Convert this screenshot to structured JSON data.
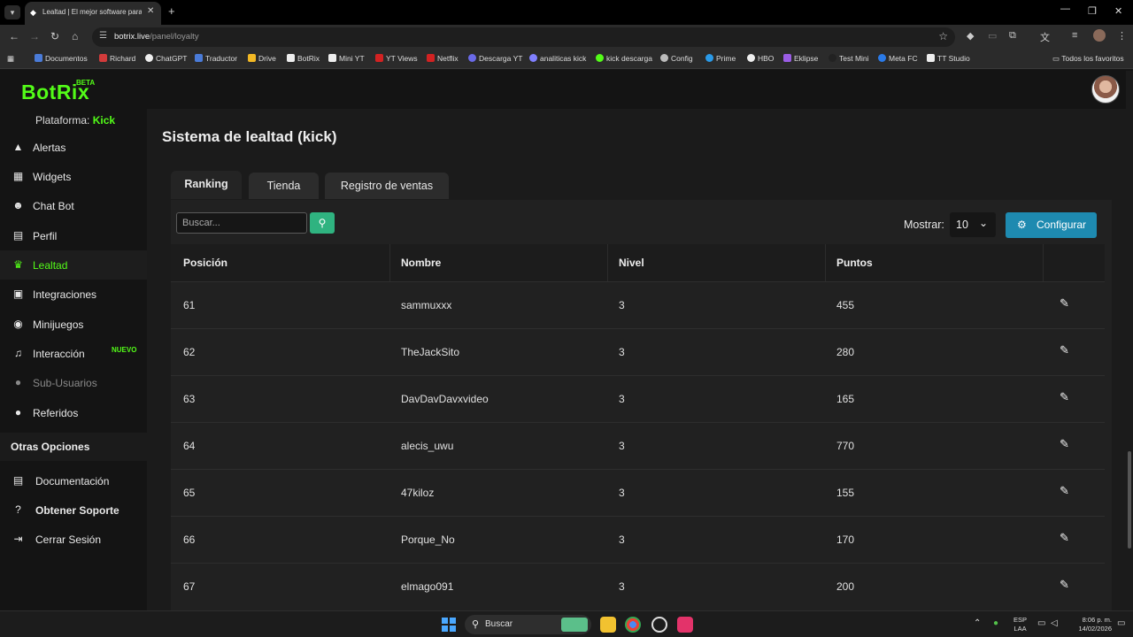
{
  "browser": {
    "tab_title": "Lealtad | El mejor software para",
    "url_host": "botrix.live",
    "url_path": "/panel/loyalty",
    "bookmarks": [
      {
        "label": "Documentos",
        "color": "#4a7bd8"
      },
      {
        "label": "Richard",
        "color": "#d23b3b"
      },
      {
        "label": "ChatGPT",
        "color": "#eeeeee"
      },
      {
        "label": "Traductor",
        "color": "#4a7bd8"
      },
      {
        "label": "Drive",
        "color": "#f2b824"
      },
      {
        "label": "BotRix",
        "color": "#eeeeee"
      },
      {
        "label": "Mini YT",
        "color": "#eeeeee"
      },
      {
        "label": "YT Views",
        "color": "#d22222"
      },
      {
        "label": "Netflix",
        "color": "#d22222"
      },
      {
        "label": "Descarga YT",
        "color": "#6a6ae8"
      },
      {
        "label": "analiticas kick",
        "color": "#8080ff"
      },
      {
        "label": "kick descarga",
        "color": "#53fc18"
      },
      {
        "label": "Config",
        "color": "#bbbbbb"
      },
      {
        "label": "Prime",
        "color": "#2a9ae8"
      },
      {
        "label": "HBO",
        "color": "#eeeeee"
      },
      {
        "label": "Eklipse",
        "color": "#9b5de5"
      },
      {
        "label": "Test Mini",
        "color": "#222222"
      },
      {
        "label": "Meta FC",
        "color": "#2a7ae8"
      },
      {
        "label": "TT Studio",
        "color": "#eeeeee"
      }
    ],
    "all_bookmarks": "Todos los favoritos"
  },
  "app": {
    "logo": "BotRix",
    "beta": "BETA",
    "platform_label": "Plataforma:",
    "platform_value": "Kick",
    "accent": "#53fc18"
  },
  "sidebar": {
    "items": [
      {
        "label": "Alertas",
        "icon": "warning-icon"
      },
      {
        "label": "Widgets",
        "icon": "grid-icon"
      },
      {
        "label": "Chat Bot",
        "icon": "robot-icon"
      },
      {
        "label": "Perfil",
        "icon": "id-card-icon"
      },
      {
        "label": "Lealtad",
        "icon": "trophy-icon",
        "active": true
      },
      {
        "label": "Integraciones",
        "icon": "box-icon"
      },
      {
        "label": "Minijuegos",
        "icon": "gamepad-icon"
      },
      {
        "label": "Interacción",
        "icon": "music-icon",
        "badge": "NUEVO"
      },
      {
        "label": "Sub-Usuarios",
        "icon": "users-icon",
        "disabled": true
      },
      {
        "label": "Referidos",
        "icon": "user-group-icon"
      }
    ],
    "other_title": "Otras Opciones",
    "other_items": [
      {
        "label": "Documentación",
        "icon": "book-icon"
      },
      {
        "label": "Obtener Soporte",
        "icon": "help-icon"
      },
      {
        "label": "Cerrar Sesión",
        "icon": "logout-icon"
      }
    ]
  },
  "main": {
    "title": "Sistema de lealtad (kick)",
    "tabs": [
      "Ranking",
      "Tienda",
      "Registro de ventas"
    ],
    "search_placeholder": "Buscar...",
    "show_label": "Mostrar:",
    "show_value": "10",
    "config_label": "Configurar",
    "columns": [
      "Posición",
      "Nombre",
      "Nivel",
      "Puntos"
    ],
    "rows": [
      {
        "pos": "61",
        "name": "sammuxxx",
        "level": "3",
        "points": "455"
      },
      {
        "pos": "62",
        "name": "TheJackSito",
        "level": "3",
        "points": "280"
      },
      {
        "pos": "63",
        "name": "DavDavDavxvideo",
        "level": "3",
        "points": "165"
      },
      {
        "pos": "64",
        "name": "alecis_uwu",
        "level": "3",
        "points": "770"
      },
      {
        "pos": "65",
        "name": "47kiloz",
        "level": "3",
        "points": "155"
      },
      {
        "pos": "66",
        "name": "Porque_No",
        "level": "3",
        "points": "170"
      },
      {
        "pos": "67",
        "name": "elmago091",
        "level": "3",
        "points": "200"
      }
    ]
  },
  "taskbar": {
    "search": "Buscar",
    "lang1": "ESP",
    "lang2": "LAA",
    "time": "8:06 p. m.",
    "date": "14/02/2026"
  }
}
